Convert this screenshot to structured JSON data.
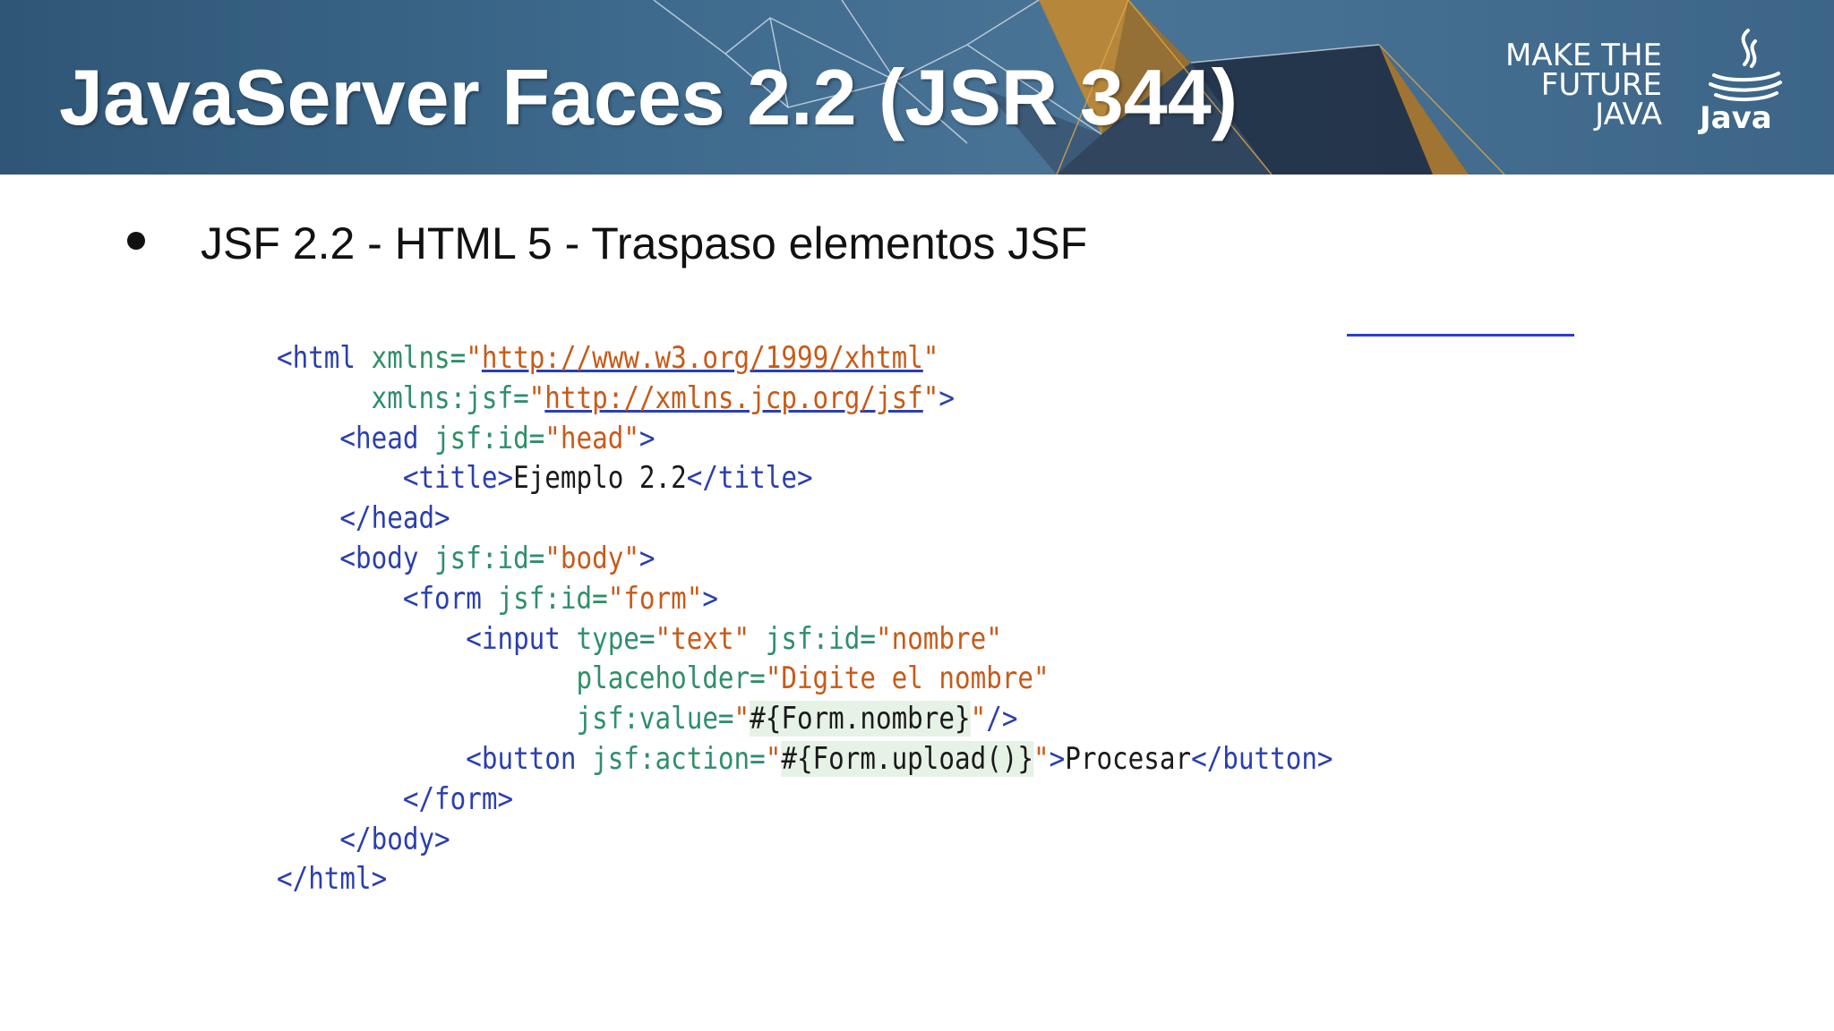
{
  "header": {
    "title": "JavaServer Faces 2.2 (JSR 344)",
    "tagline": [
      "MAKE THE",
      "FUTURE",
      "JAVA"
    ],
    "logo_text": "Java",
    "logo_icon": "java-coffee-cup-icon"
  },
  "bullet": {
    "text": "JSF 2.2 - HTML 5 - Traspaso elementos JSF"
  },
  "code": {
    "lines": [
      [
        {
          "c": "tg",
          "t": "<html "
        },
        {
          "c": "at",
          "t": "xmlns="
        },
        {
          "c": "st",
          "t": "\""
        },
        {
          "c": "url",
          "t": "http://www.w3.org/1999/xhtml"
        },
        {
          "c": "st",
          "t": "\""
        }
      ],
      [
        {
          "c": "tx",
          "t": "      "
        },
        {
          "c": "at",
          "t": "xmlns:jsf="
        },
        {
          "c": "st",
          "t": "\""
        },
        {
          "c": "url",
          "t": "http://xmlns.jcp.org/jsf"
        },
        {
          "c": "st",
          "t": "\""
        },
        {
          "c": "tg",
          "t": ">"
        }
      ],
      [
        {
          "c": "tx",
          "t": "    "
        },
        {
          "c": "tg",
          "t": "<head "
        },
        {
          "c": "at",
          "t": "jsf:id="
        },
        {
          "c": "st",
          "t": "\"head\""
        },
        {
          "c": "tg",
          "t": ">"
        }
      ],
      [
        {
          "c": "tx",
          "t": "        "
        },
        {
          "c": "tg",
          "t": "<title>"
        },
        {
          "c": "tx",
          "t": "Ejemplo 2.2"
        },
        {
          "c": "tg",
          "t": "</title>"
        }
      ],
      [
        {
          "c": "tx",
          "t": "    "
        },
        {
          "c": "tg",
          "t": "</head>"
        }
      ],
      [
        {
          "c": "tx",
          "t": "    "
        },
        {
          "c": "tg",
          "t": "<body "
        },
        {
          "c": "at",
          "t": "jsf:id="
        },
        {
          "c": "st",
          "t": "\"body\""
        },
        {
          "c": "tg",
          "t": ">"
        }
      ],
      [
        {
          "c": "tx",
          "t": "        "
        },
        {
          "c": "tg",
          "t": "<form "
        },
        {
          "c": "at",
          "t": "jsf:id="
        },
        {
          "c": "st",
          "t": "\"form\""
        },
        {
          "c": "tg",
          "t": ">"
        }
      ],
      [
        {
          "c": "tx",
          "t": "            "
        },
        {
          "c": "tg",
          "t": "<input "
        },
        {
          "c": "at",
          "t": "type="
        },
        {
          "c": "st",
          "t": "\"text\" "
        },
        {
          "c": "at",
          "t": "jsf:id="
        },
        {
          "c": "st",
          "t": "\"nombre\""
        }
      ],
      [
        {
          "c": "tx",
          "t": "                   "
        },
        {
          "c": "at",
          "t": "placeholder="
        },
        {
          "c": "st",
          "t": "\"Digite el nombre\""
        }
      ],
      [
        {
          "c": "tx",
          "t": "                   "
        },
        {
          "c": "at",
          "t": "jsf:value="
        },
        {
          "c": "st",
          "t": "\""
        },
        {
          "c": "hl",
          "t": "#{Form.nombre}"
        },
        {
          "c": "st",
          "t": "\""
        },
        {
          "c": "tg",
          "t": "/>"
        }
      ],
      [
        {
          "c": "tx",
          "t": "            "
        },
        {
          "c": "tg",
          "t": "<button "
        },
        {
          "c": "at",
          "t": "jsf:action="
        },
        {
          "c": "st",
          "t": "\""
        },
        {
          "c": "hl",
          "t": "#{Form.upload()}"
        },
        {
          "c": "st",
          "t": "\""
        },
        {
          "c": "tg",
          "t": ">"
        },
        {
          "c": "tx",
          "t": "Procesar"
        },
        {
          "c": "tg",
          "t": "</button>"
        }
      ],
      [
        {
          "c": "tx",
          "t": "        "
        },
        {
          "c": "tg",
          "t": "</form>"
        }
      ],
      [
        {
          "c": "tx",
          "t": "    "
        },
        {
          "c": "tg",
          "t": "</body>"
        }
      ],
      [
        {
          "c": "tg",
          "t": "</html>"
        }
      ]
    ]
  }
}
